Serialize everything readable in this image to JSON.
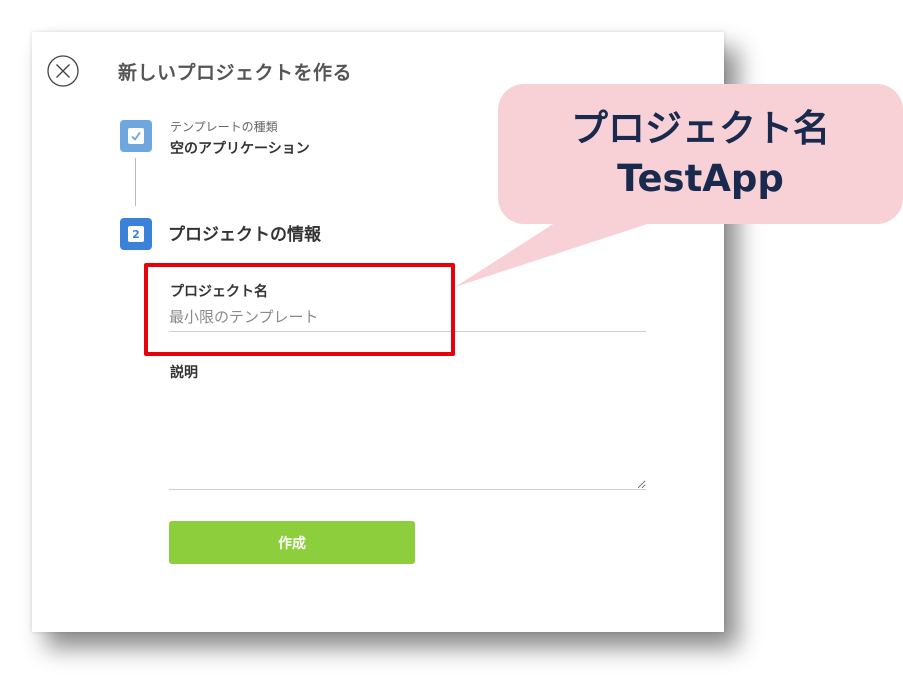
{
  "dialog": {
    "title": "新しいプロジェクトを作る",
    "close_icon": "close-icon"
  },
  "steps": [
    {
      "number": "1",
      "state": "completed",
      "icon": "check-icon",
      "subtitle": "テンプレートの種類",
      "value": "空のアプリケーション"
    },
    {
      "number": "2",
      "state": "active",
      "title": "プロジェクトの情報"
    }
  ],
  "form": {
    "name_label": "プロジェクト名",
    "name_placeholder": "最小限のテンプレート",
    "name_value": "",
    "description_label": "説明",
    "description_value": "",
    "submit_label": "作成"
  },
  "annotation": {
    "line1": "プロジェクト名",
    "line2": "TestApp",
    "callout_color": "#f7d1d6",
    "highlight_color": "#e8000b"
  },
  "colors": {
    "submit_button": "#8dce3d",
    "step_active": "#3a82d9",
    "step_completed": "#6fa6e0"
  }
}
